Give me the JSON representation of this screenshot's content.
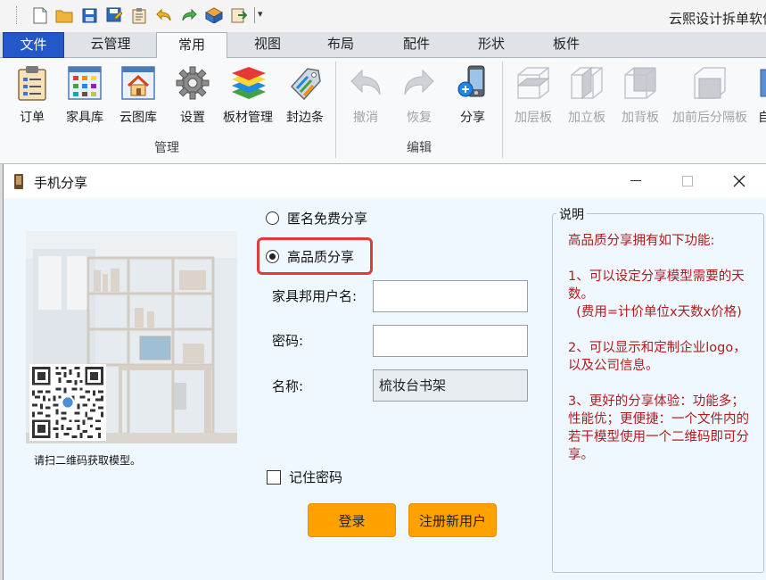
{
  "app": {
    "title": "云熙设计拆单软件"
  },
  "qat": {
    "icons": [
      "grip-handle",
      "new-file-icon",
      "open-folder-icon",
      "save-icon",
      "save-as-icon",
      "clipboard-icon",
      "undo-icon",
      "redo-icon",
      "package-icon",
      "export-icon",
      "customize-dropdown-icon"
    ]
  },
  "tabs": [
    {
      "label": "文件"
    },
    {
      "label": "云管理"
    },
    {
      "label": "常用"
    },
    {
      "label": "视图"
    },
    {
      "label": "布局"
    },
    {
      "label": "配件"
    },
    {
      "label": "形状"
    },
    {
      "label": "板件"
    }
  ],
  "ribbon": {
    "groups": [
      {
        "label": "管理"
      },
      {
        "label": "编辑"
      }
    ],
    "buttons": [
      {
        "label": "订单",
        "icon": "clipboard-icon"
      },
      {
        "label": "家具库",
        "icon": "palette-grid-icon"
      },
      {
        "label": "云图库",
        "icon": "house-icon"
      },
      {
        "label": "设置",
        "icon": "gear-icon"
      },
      {
        "label": "板材管理",
        "icon": "layers-icon"
      },
      {
        "label": "封边条",
        "icon": "tag-icon"
      },
      {
        "label": "撤消",
        "icon": "undo-icon"
      },
      {
        "label": "恢复",
        "icon": "redo-icon"
      },
      {
        "label": "分享",
        "icon": "phone-share-icon"
      },
      {
        "label": "加层板",
        "icon": "shelf-board-icon"
      },
      {
        "label": "加立板",
        "icon": "vertical-board-icon"
      },
      {
        "label": "加背板",
        "icon": "back-board-icon"
      },
      {
        "label": "加前后分隔板",
        "icon": "divider-board-icon"
      },
      {
        "label": "自",
        "icon": "custom-icon"
      }
    ]
  },
  "dialog": {
    "title": "手机分享",
    "qr_caption": "请扫二维码获取模型。",
    "options": [
      {
        "label": "匿名免费分享",
        "checked": false
      },
      {
        "label": "高品质分享",
        "checked": true
      }
    ],
    "fields": {
      "username_label": "家具邦用户名:",
      "username_value": "",
      "password_label": "密码:",
      "password_value": "",
      "name_label": "名称:",
      "name_value": "梳妆台书架"
    },
    "remember_label": "记住密码",
    "login_button": "登录",
    "register_button": "注册新用户",
    "description": {
      "legend": "说明",
      "text": "高品质分享拥有如下功能:\n\n1、可以设定分享模型需要的天数。\n  (费用=计价单位x天数x价格)\n\n2、可以显示和定制企业logo，以及公司信息。\n\n3、更好的分享体验：功能多；性能优；更便捷：一个文件内的若干模型使用一个二维码即可分享。"
    }
  },
  "colors": {
    "accent_orange": "#ffa200",
    "file_tab_blue": "#2457c8",
    "highlight_red": "#e2393a",
    "description_text": "#b01c1c"
  }
}
